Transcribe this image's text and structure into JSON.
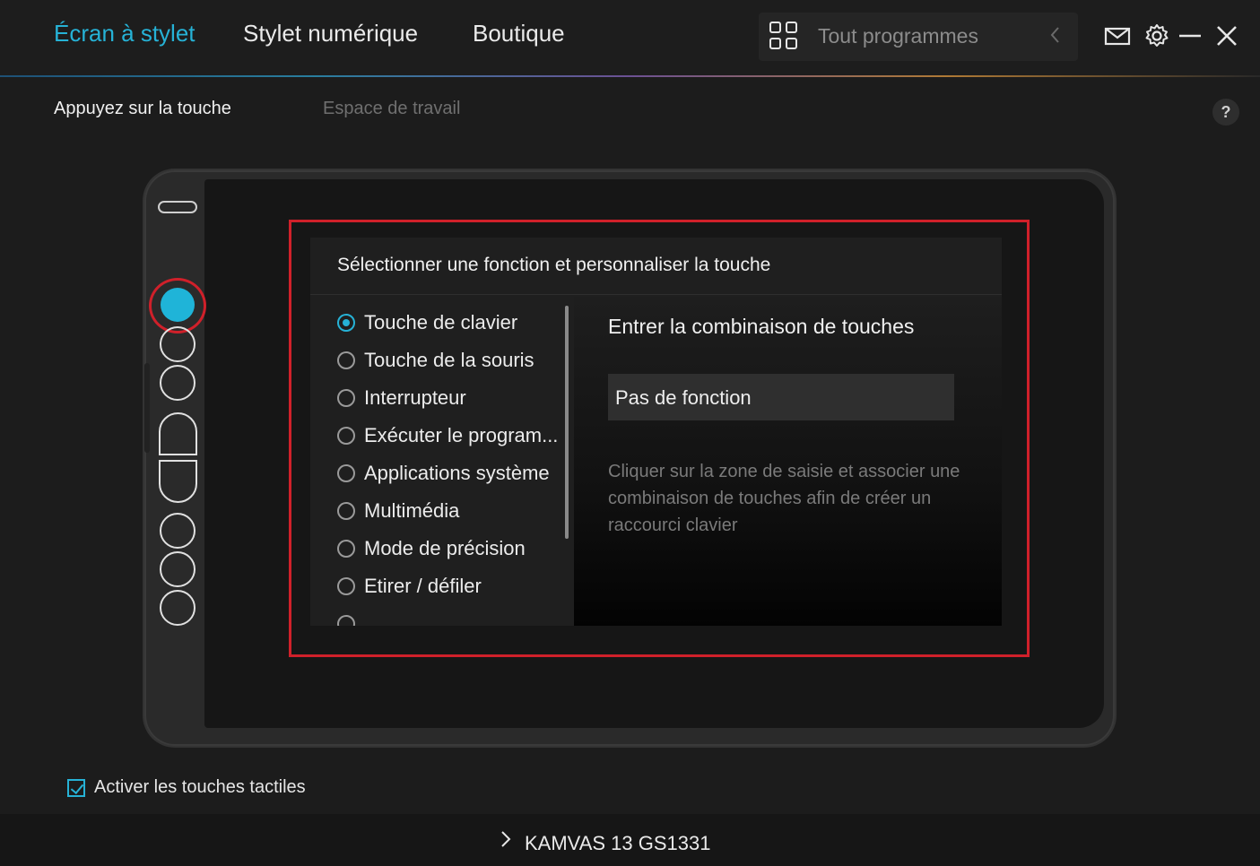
{
  "tabs": [
    {
      "label": "Écran à stylet",
      "active": true
    },
    {
      "label": "Stylet numérique",
      "active": false
    },
    {
      "label": "Boutique",
      "active": false
    }
  ],
  "program_selector": {
    "label": "Tout programmes"
  },
  "subtabs": [
    {
      "label": "Appuyez sur la touche",
      "active": true
    },
    {
      "label": "Espace de travail",
      "active": false
    }
  ],
  "help_label": "?",
  "panel": {
    "header": "Sélectionner une fonction et personnaliser la touche",
    "options": [
      {
        "label": "Touche de clavier",
        "selected": true
      },
      {
        "label": "Touche de la souris",
        "selected": false
      },
      {
        "label": "Interrupteur",
        "selected": false
      },
      {
        "label": "Exécuter le program...",
        "selected": false
      },
      {
        "label": "Applications système",
        "selected": false
      },
      {
        "label": "Multimédia",
        "selected": false
      },
      {
        "label": "Mode de précision",
        "selected": false
      },
      {
        "label": "Etirer / défiler",
        "selected": false
      }
    ],
    "right_title": "Entrer la combinaison de touches",
    "input_value": "Pas de fonction",
    "hint": "Cliquer sur la zone de saisie et associer une combinaison de touches afin de créer un raccourci clavier"
  },
  "enable_touch": {
    "label": "Activer les touches tactiles",
    "checked": true
  },
  "footer": {
    "device_name": "KAMVAS 13 GS1331"
  },
  "colors": {
    "accent": "#26b2d6",
    "highlight": "#d0202a",
    "background": "#1c1c1c"
  },
  "icons": [
    "grid-icon",
    "chevron-left-icon",
    "mail-icon",
    "gear-icon",
    "minimize-icon",
    "close-icon",
    "chevron-right-icon",
    "check-icon"
  ]
}
